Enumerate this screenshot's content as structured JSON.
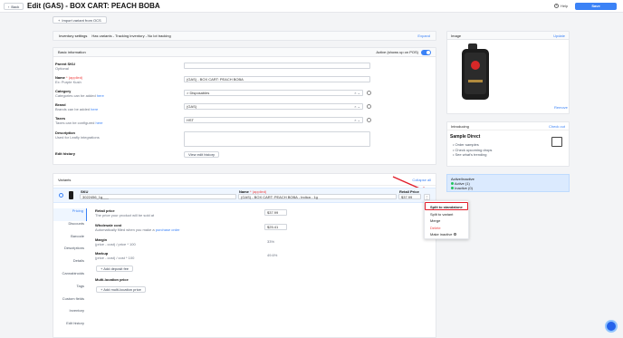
{
  "header": {
    "back_label": "Back",
    "title": "Edit (GAS) - BOX CART: PEACH BOBA",
    "help_label": "Help",
    "save_label": "Save"
  },
  "import_label": "Import variant from OCS",
  "inventory": {
    "label": "Inventory settings",
    "status": "Has variants - Tracking inventory - No lot tracking",
    "action": "Expand"
  },
  "basic": {
    "title": "Basic information",
    "active_label": "Active (shows up on POS)",
    "parent_sku_label": "Parent SKU",
    "parent_sku_hint": "Optional",
    "name_label": "Name",
    "name_required": "* (applied)",
    "name_hint": "Ex: Purple Kush",
    "name_value": "(GAS) - BOX CART: PEACH BOBA",
    "category_label": "Category",
    "category_hint": "Categories can be added",
    "category_link": "here",
    "category_value": "> Disposables",
    "brand_label": "Brand",
    "brand_hint": "Brands can be added",
    "brand_link": "here",
    "brand_value": "(GAS)",
    "taxes_label": "Taxes",
    "taxes_hint": "Taxes can be configured",
    "taxes_link": "here",
    "taxes_value": "HST",
    "desc_label": "Description",
    "desc_hint": "Used for Leafly integrations",
    "edit_history_label": "Edit history",
    "view_history_button": "View edit history"
  },
  "image_panel": {
    "title": "Image",
    "update": "Update",
    "remove": "Remove"
  },
  "intro": {
    "title": "Introducing",
    "check": "Check out",
    "product": "Sample Direct",
    "bullets": [
      "Order samples",
      "Check upcoming drops",
      "See what's trending"
    ]
  },
  "active_inactive": {
    "title": "Active/Inactive",
    "active": "Active (1)",
    "inactive": "Inactive (0)"
  },
  "variants": {
    "title": "Variants",
    "collapse": "Collapse all",
    "col_sku": "SKU",
    "col_name": "Name",
    "col_name_req": "* (applied)",
    "col_price": "Retail Price",
    "row_sku": "3022456_1g___",
    "row_name": "(GAS) - BOX CART: PEACH BOBA - Indica - 1g",
    "row_price": "$37.99"
  },
  "sidenav": [
    "Pricing",
    "Discounts",
    "Barcode",
    "Descriptions",
    "Details",
    "Cannabinoids",
    "Tags",
    "Custom fields",
    "Inventory",
    "Edit history"
  ],
  "pricing": {
    "retail_label": "Retail price",
    "retail_hint": "The price your product will be sold at",
    "retail_value": "$37.99",
    "wholesale_label": "Wholesale cost",
    "wholesale_hint": "Automatically filled when you make a",
    "wholesale_link": "purchase order",
    "wholesale_value": "$25.41",
    "margin_label": "Margin",
    "margin_formula": "(price - cost) / price * 100",
    "margin_value": "33%",
    "markup_label": "Markup",
    "markup_formula": "(price - cost) / cost * 100",
    "markup_value": "49.6%",
    "deposit_button": "+ Add deposit fee",
    "multi_label": "Multi-location price",
    "multi_button": "+ Add multi-location price"
  },
  "context_menu": {
    "items": [
      "Split to standalone",
      "Split to variant",
      "Merge",
      "Delete",
      "Make inactive"
    ]
  },
  "colors": {
    "primary": "#3b82f6",
    "danger": "#e11d2a",
    "success": "#22c55e"
  }
}
